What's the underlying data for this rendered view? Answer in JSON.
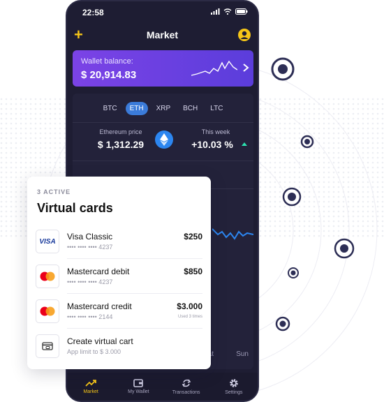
{
  "status": {
    "time": "22:58"
  },
  "header": {
    "title": "Market"
  },
  "wallet": {
    "label": "Wallet balance:",
    "value": "$ 20,914.83"
  },
  "coins": [
    "BTC",
    "ETH",
    "XRP",
    "BCH",
    "LTC"
  ],
  "price": {
    "label": "Ethereum price",
    "value": "$ 1,312.29",
    "week_label": "This week",
    "week_value": "+10.03 %"
  },
  "days": [
    "Sat",
    "Sun"
  ],
  "nav": [
    {
      "label": "Market",
      "icon": "trend-icon"
    },
    {
      "label": "My Wallet",
      "icon": "wallet-icon"
    },
    {
      "label": "Transactions",
      "icon": "sync-icon"
    },
    {
      "label": "Settings",
      "icon": "gear-icon"
    }
  ],
  "cards": {
    "count_label": "3 ACTIVE",
    "title": "Virtual cards",
    "items": [
      {
        "name": "Visa Classic",
        "number": "•••• •••• •••• 4237",
        "amount": "$250",
        "sub": "",
        "logo": "visa",
        "logo_text": "VISA"
      },
      {
        "name": "Mastercard debit",
        "number": "•••• •••• •••• 4237",
        "amount": "$850",
        "sub": "",
        "logo": "mastercard"
      },
      {
        "name": "Mastercard credit",
        "number": "•••• •••• •••• 2144",
        "amount": "$3.000",
        "sub": "Used 3 times",
        "logo": "mastercard"
      },
      {
        "name": "Create virtual cart",
        "number": "App limit to $ 3.000",
        "amount": "",
        "sub": "",
        "logo": "card-icon"
      }
    ]
  },
  "colors": {
    "accent": "#f5c518",
    "wallet": "#6a40e0",
    "chart": "#2c86f0",
    "positive": "#2ce3b0"
  }
}
